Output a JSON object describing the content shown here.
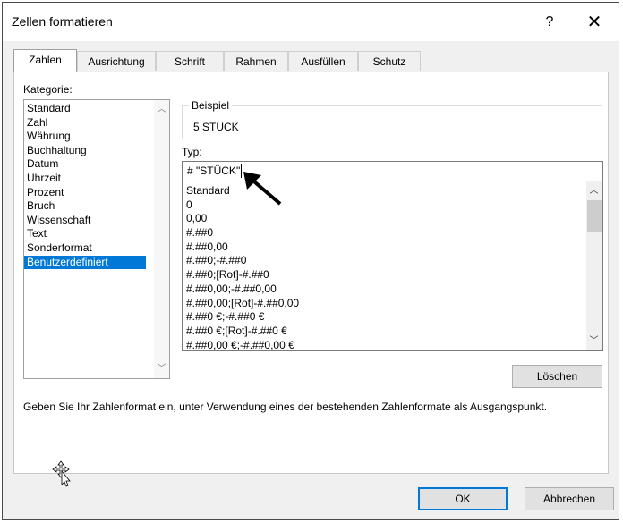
{
  "dialog": {
    "title": "Zellen formatieren",
    "help": "?",
    "close": "✕"
  },
  "tabs": [
    {
      "label": "Zahlen"
    },
    {
      "label": "Ausrichtung"
    },
    {
      "label": "Schrift"
    },
    {
      "label": "Rahmen"
    },
    {
      "label": "Ausfüllen"
    },
    {
      "label": "Schutz"
    }
  ],
  "kategorie": {
    "label": "Kategorie:",
    "items": [
      "Standard",
      "Zahl",
      "Währung",
      "Buchhaltung",
      "Datum",
      "Uhrzeit",
      "Prozent",
      "Bruch",
      "Wissenschaft",
      "Text",
      "Sonderformat",
      "Benutzerdefiniert"
    ],
    "selected": "Benutzerdefiniert"
  },
  "beispiel": {
    "legend": "Beispiel",
    "value": "5 STÜCK"
  },
  "typ": {
    "label": "Typ:",
    "value": "# \"STÜCK\"",
    "formats": [
      "Standard",
      "0",
      "0,00",
      "#.##0",
      "#.##0,00",
      "#.##0;-#.##0",
      "#.##0;[Rot]-#.##0",
      "#.##0,00;-#.##0,00",
      "#.##0,00;[Rot]-#.##0,00",
      "#.##0 €;-#.##0 €",
      "#.##0 €;[Rot]-#.##0 €",
      "#.##0,00 €;-#.##0,00 €"
    ]
  },
  "buttons": {
    "delete": "Löschen",
    "ok": "OK",
    "cancel": "Abbrechen"
  },
  "hint": "Geben Sie Ihr Zahlenformat ein, unter Verwendung eines der bestehenden Zahlenformate als Ausgangspunkt.",
  "colors": {
    "selection": "#0078d7",
    "primary_border": "#0078d7"
  }
}
